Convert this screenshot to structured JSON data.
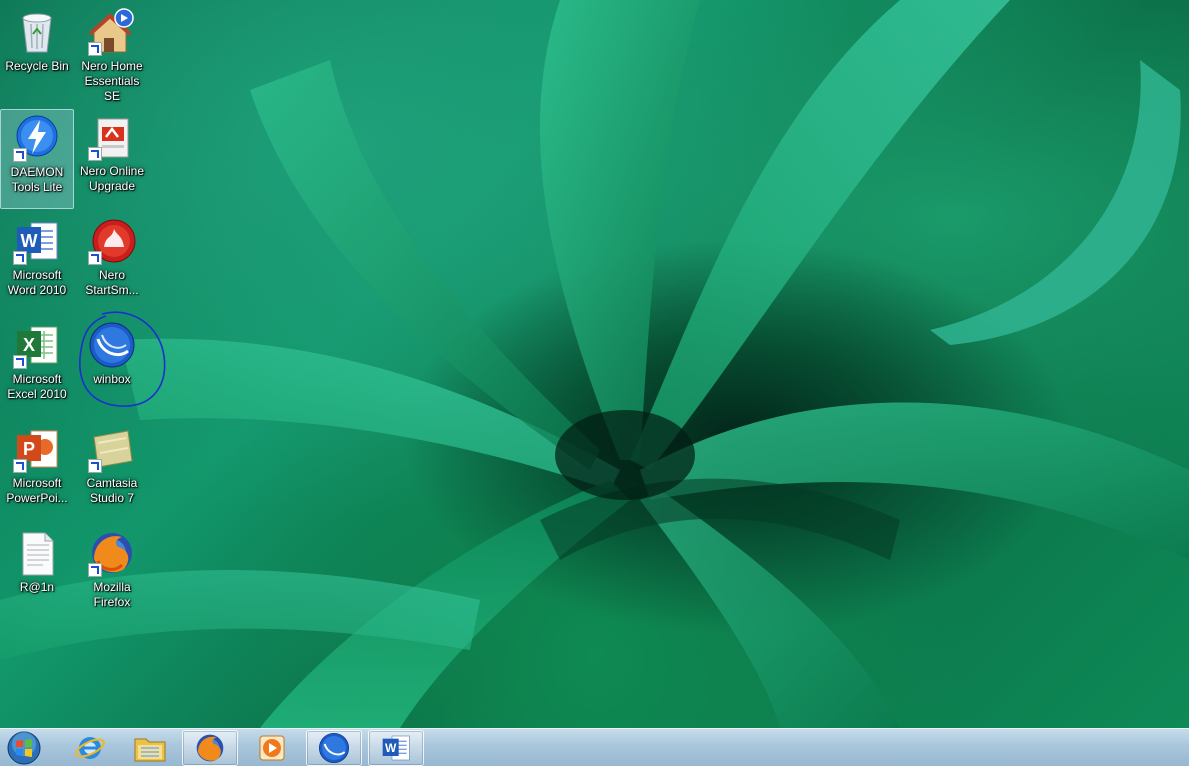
{
  "desktop": {
    "icons": [
      {
        "label": "Recycle Bin",
        "icon": "recycle-bin-icon"
      },
      {
        "label": "Nero Home Essentials SE",
        "icon": "nero-home-icon"
      },
      {
        "label": "DAEMON Tools Lite",
        "icon": "daemon-tools-icon"
      },
      {
        "label": "Nero Online Upgrade",
        "icon": "nero-upgrade-icon"
      },
      {
        "label": "Microsoft Word 2010",
        "icon": "word-icon"
      },
      {
        "label": "Nero StartSm...",
        "icon": "nero-startsmart-icon"
      },
      {
        "label": "Microsoft Excel 2010",
        "icon": "excel-icon"
      },
      {
        "label": "winbox",
        "icon": "winbox-icon"
      },
      {
        "label": "Microsoft PowerPoi...",
        "icon": "powerpoint-icon"
      },
      {
        "label": "Camtasia Studio 7",
        "icon": "camtasia-icon"
      },
      {
        "label": "R@1n",
        "icon": "text-document-icon"
      },
      {
        "label": "Mozilla Firefox",
        "icon": "firefox-icon"
      }
    ],
    "annotation_color": "#1a2fd0"
  },
  "taskbar": {
    "buttons": [
      {
        "name": "start-button",
        "icon": "windows-orb-icon"
      },
      {
        "name": "internet-explorer",
        "icon": "internet-explorer-icon"
      },
      {
        "name": "windows-explorer",
        "icon": "folder-icon"
      },
      {
        "name": "firefox",
        "icon": "firefox-icon"
      },
      {
        "name": "media-player",
        "icon": "media-player-icon"
      },
      {
        "name": "winbox",
        "icon": "winbox-icon"
      },
      {
        "name": "word",
        "icon": "word-icon"
      }
    ]
  }
}
